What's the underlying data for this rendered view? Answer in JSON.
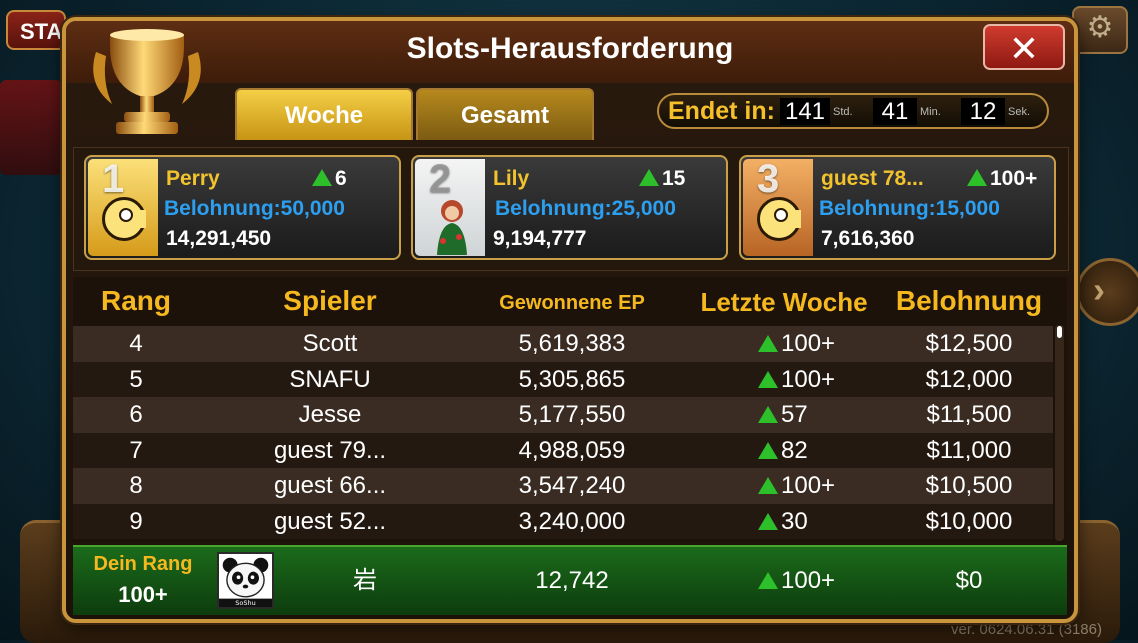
{
  "background": {
    "start_label": "STA",
    "version": "ver. 0624.06.31 (3186)"
  },
  "dialog": {
    "title": "Slots-Herausforderung",
    "close_label": "✕"
  },
  "tabs": [
    {
      "label": "Woche",
      "active": true
    },
    {
      "label": "Gesamt",
      "active": false
    }
  ],
  "timer": {
    "label": "Endet in:",
    "hours": "141",
    "hours_unit": "Std.",
    "minutes": "41",
    "minutes_unit": "Min.",
    "seconds": "12",
    "seconds_unit": "Sek."
  },
  "top_players": [
    {
      "rank": "1",
      "name": "Perry",
      "change": "6",
      "reward": "Belohnung:50,000",
      "score": "14,291,450"
    },
    {
      "rank": "2",
      "name": "Lily",
      "change": "15",
      "reward": "Belohnung:25,000",
      "score": "9,194,777"
    },
    {
      "rank": "3",
      "name": "guest 78...",
      "change": "100+",
      "reward": "Belohnung:15,000",
      "score": "7,616,360"
    }
  ],
  "table": {
    "headers": {
      "rank": "Rang",
      "player": "Spieler",
      "ep": "Gewonnene EP",
      "last_week": "Letzte Woche",
      "reward": "Belohnung"
    },
    "rows": [
      {
        "rank": "4",
        "player": "Scott",
        "ep": "5,619,383",
        "last_week": "100+",
        "reward": "$12,500"
      },
      {
        "rank": "5",
        "player": "SNAFU",
        "ep": "5,305,865",
        "last_week": "100+",
        "reward": "$12,000"
      },
      {
        "rank": "6",
        "player": "Jesse",
        "ep": "5,177,550",
        "last_week": "57",
        "reward": "$11,500"
      },
      {
        "rank": "7",
        "player": "guest 79...",
        "ep": "4,988,059",
        "last_week": "82",
        "reward": "$11,000"
      },
      {
        "rank": "8",
        "player": "guest 66...",
        "ep": "3,547,240",
        "last_week": "100+",
        "reward": "$10,500"
      },
      {
        "rank": "9",
        "player": "guest 52...",
        "ep": "3,240,000",
        "last_week": "30",
        "reward": "$10,000"
      }
    ]
  },
  "my_rank": {
    "label": "Dein Rang",
    "rank": "100+",
    "avatar_caption": "SoShu",
    "player": "岩",
    "ep": "12,742",
    "last_week": "100+",
    "reward": "$0"
  },
  "colors": {
    "gold": "#f5b81f",
    "reward_blue": "#2c9ff0",
    "up_green": "#2dc02b",
    "frame": "#c8953d"
  },
  "icons": {
    "close": "close-icon",
    "up": "arrow-up-icon",
    "trophy": "trophy-icon",
    "settings": "gear-icon"
  }
}
